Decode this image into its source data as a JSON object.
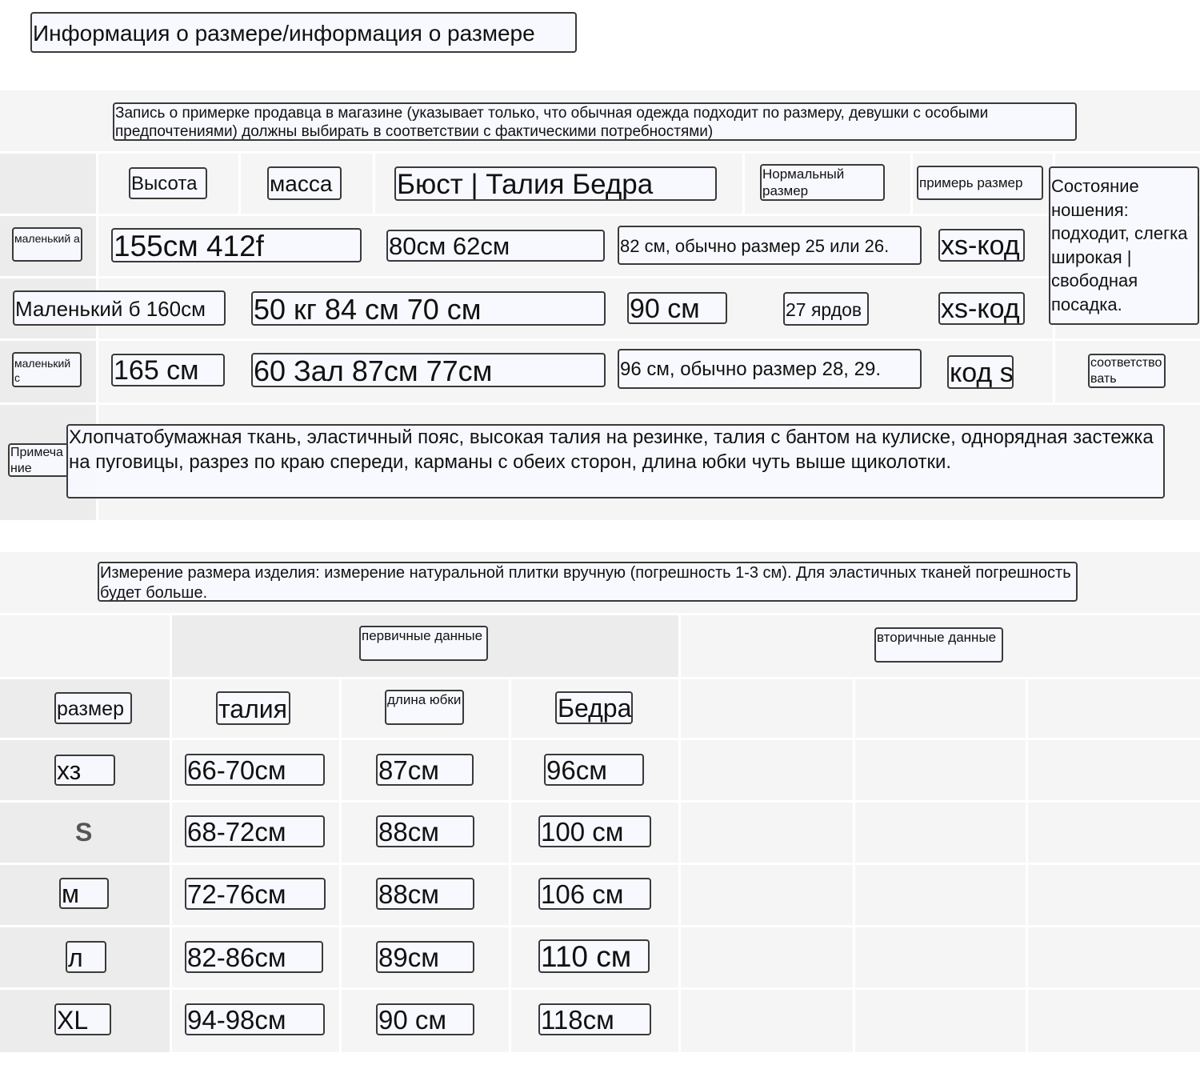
{
  "title": "Информация о размере/информация о размере",
  "fitting": {
    "intro": "Запись о примерке продавца в магазине (указывает только, что обычная одежда подходит по размеру, девушки с особыми предпочтениями) должны выбирать в соответствии с фактическими потребностями)",
    "headers": {
      "height": "Высота",
      "weight": "масса",
      "measurements": "Бюст | Талия Бедра",
      "normal_size": "Нормальный размер",
      "try_size": "примерь размер",
      "wear_state": "Состояние ношения: подходит, слегка широкая | свободная посадка."
    },
    "rows": [
      {
        "model": "маленький а",
        "height_weight": "155см 412f",
        "bust_waist": "80см 62см",
        "hip_size": "82 см, обычно размер 25 или 26.",
        "try_size": "xs-код"
      },
      {
        "model_height": "Маленький б 160см",
        "weight_bust_waist": "50 кг 84 см 70 см",
        "hip": "90 см",
        "normal_size": "27 ярдов",
        "try_size": "xs-код"
      },
      {
        "model": "маленький с",
        "height": "165 см",
        "weight_bust_waist": "60 Зал 87см 77см",
        "hip_size": "96 см, обычно размер 28, 29.",
        "try_size": "код s",
        "state": "соответствовать"
      }
    ],
    "note_label": "Примечание",
    "note": "Хлопчатобумажная ткань, эластичный пояс, высокая талия на резинке, талия с бантом на кулиске, однорядная застежка на пуговицы, разрез по краю спереди, карманы с обеих сторон, длина юбки чуть выше щиколотки."
  },
  "measure": {
    "intro": "Измерение размера изделия: измерение натуральной плитки вручную (погрешность 1-3 см). Для эластичных тканей погрешность будет больше.",
    "primary_label": "первичные данные",
    "secondary_label": "вторичные данные",
    "headers": {
      "size": "размер",
      "waist": "талия",
      "skirt_length": "длина юбки",
      "hip": "Бедра"
    },
    "rows": [
      {
        "size": "хз",
        "waist": "66-70см",
        "length": "87см",
        "hip": "96см"
      },
      {
        "size": "S",
        "waist": "68-72см",
        "length": "88см",
        "hip": "100 см"
      },
      {
        "size": "м",
        "waist": "72-76см",
        "length": "88см",
        "hip": "106 см"
      },
      {
        "size": "л",
        "waist": "82-86см",
        "length": "89см",
        "hip": "110 см"
      },
      {
        "size": "XL",
        "waist": "94-98см",
        "length": "90 см",
        "hip": "118см"
      }
    ]
  }
}
